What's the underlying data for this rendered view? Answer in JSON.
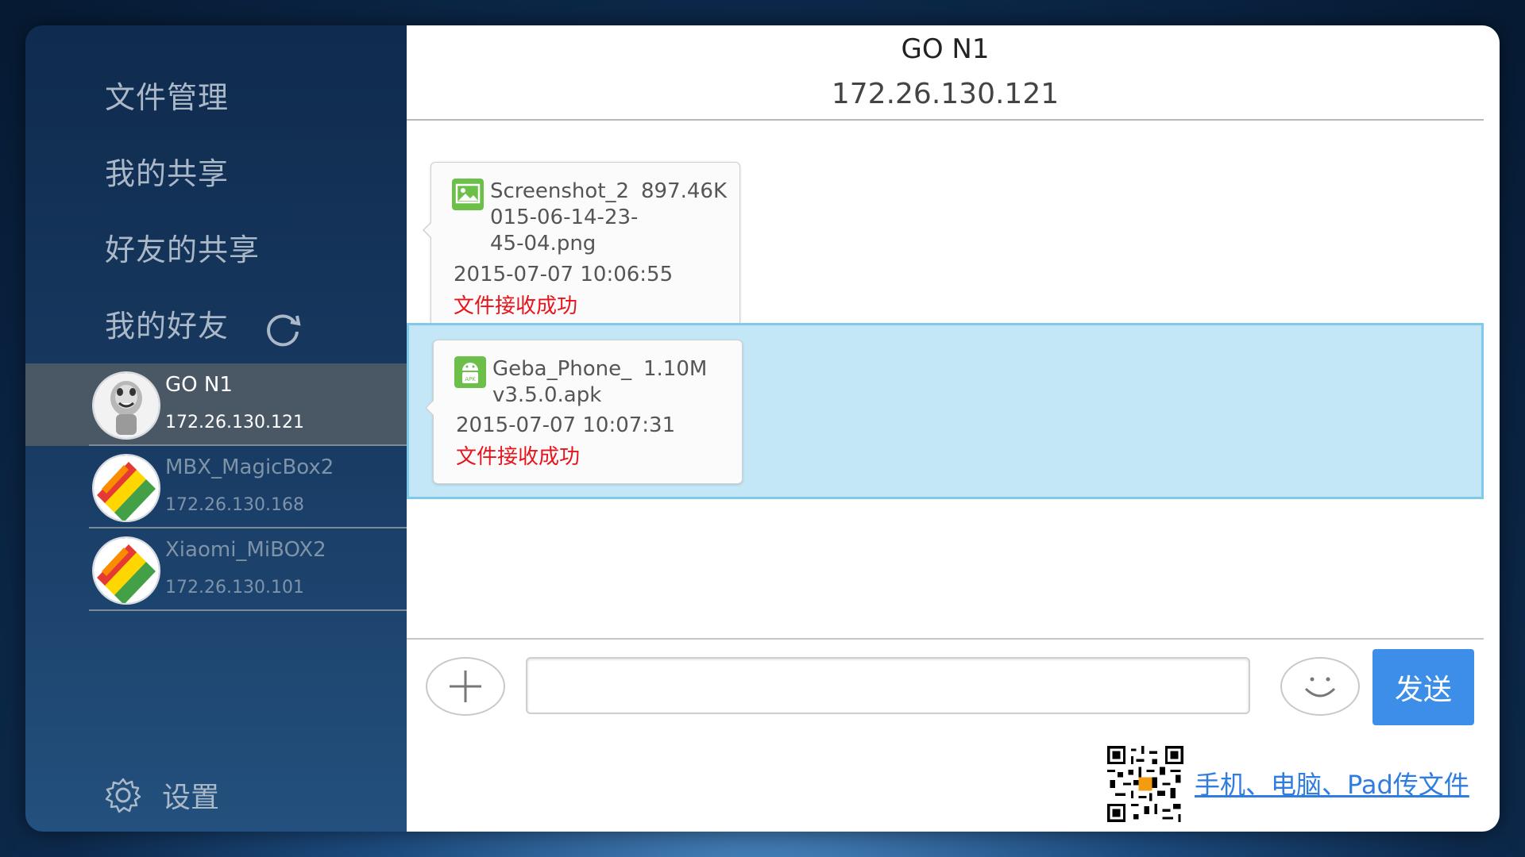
{
  "sidebar": {
    "nav": [
      {
        "label": "文件管理"
      },
      {
        "label": "我的共享"
      },
      {
        "label": "好友的共享"
      },
      {
        "label": "我的好友"
      }
    ],
    "friends": [
      {
        "name": "GO N1",
        "ip": "172.26.130.121",
        "selected": true
      },
      {
        "name": "MBX_MagicBox2",
        "ip": "172.26.130.168",
        "selected": false
      },
      {
        "name": "Xiaomi_MiBOX2",
        "ip": "172.26.130.101",
        "selected": false
      }
    ],
    "settings_label": "设置"
  },
  "chat": {
    "title": "GO N1",
    "ip": "172.26.130.121",
    "messages": [
      {
        "icon": "image-file-icon",
        "file_name": "Screenshot_2015-06-14-23-45-04.png",
        "size": "897.46K",
        "time": "2015-07-07 10:06:55",
        "status": "文件接收成功"
      },
      {
        "icon": "apk-file-icon",
        "file_name": "Geba_Phone_v3.5.0.apk",
        "size": "1.10M",
        "time": "2015-07-07 10:07:31",
        "status": "文件接收成功"
      }
    ]
  },
  "composer": {
    "input_value": "",
    "send_label": "发送"
  },
  "promo": {
    "link_text": "手机、电脑、Pad传文件"
  },
  "colors": {
    "accent": "#3d8ee8",
    "status_success": "#e8141b",
    "highlight_row": "#c3e7f6"
  }
}
